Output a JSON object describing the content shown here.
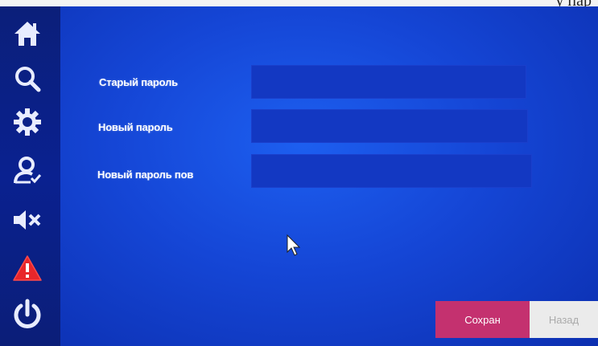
{
  "top_strip_text": "у пар",
  "sidebar": {
    "items": [
      {
        "name": "home-icon"
      },
      {
        "name": "search-icon"
      },
      {
        "name": "gear-icon"
      },
      {
        "name": "user-check-icon"
      },
      {
        "name": "mute-icon"
      },
      {
        "name": "warning-icon"
      },
      {
        "name": "power-icon"
      }
    ]
  },
  "form": {
    "old_password_label": "Старый пароль",
    "new_password_label": "Новый пароль",
    "repeat_password_label": "Новый пароль пов",
    "old_password_value": "",
    "new_password_value": "",
    "repeat_password_value": ""
  },
  "buttons": {
    "save_label": "Сохран",
    "back_label": "Назад"
  },
  "colors": {
    "background": "#1546d6",
    "sidebar": "#0b1f7a",
    "input": "#1338c2",
    "save": "#c4316f",
    "back": "#ebebeb"
  }
}
